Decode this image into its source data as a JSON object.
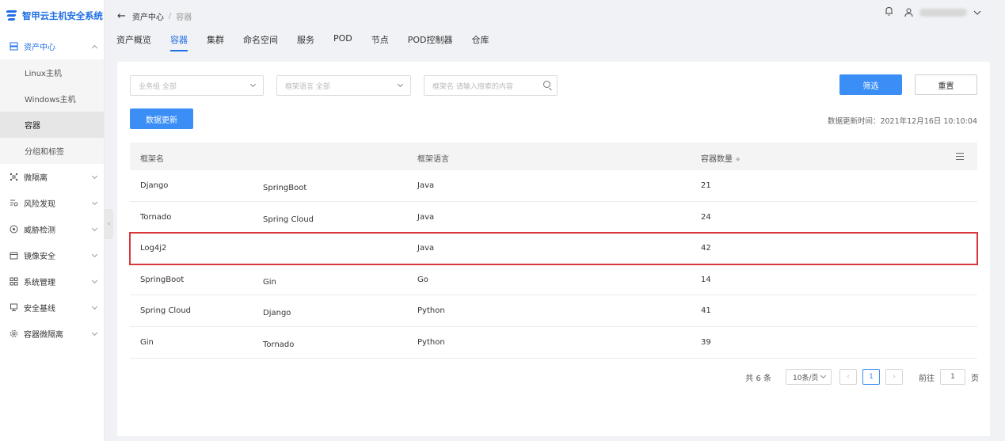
{
  "app": {
    "title": "智甲云主机安全系统"
  },
  "sidebar": {
    "groups": [
      {
        "label": "资产中心",
        "expanded": true
      },
      {
        "label": "微隔离"
      },
      {
        "label": "风险发现"
      },
      {
        "label": "威胁检测"
      },
      {
        "label": "镜像安全"
      },
      {
        "label": "系统管理"
      },
      {
        "label": "安全基线"
      },
      {
        "label": "容器微隔离"
      }
    ],
    "sub_items": [
      "Linux主机",
      "Windows主机",
      "容器",
      "分组和标签"
    ],
    "active_sub": "容器"
  },
  "header": {
    "breadcrumb": {
      "parent": "资产中心",
      "separator": "/",
      "current": "容器"
    }
  },
  "tabs": [
    "资产概览",
    "容器",
    "集群",
    "命名空间",
    "服务",
    "POD",
    "节点",
    "POD控制器",
    "仓库"
  ],
  "active_tab": "容器",
  "filters": {
    "business_group": "业务组 全部",
    "framework_language": "框架语言 全部",
    "search_placeholder": "框架名 请输入搜索的内容"
  },
  "buttons": {
    "filter": "筛选",
    "reset": "重置",
    "data_update": "数据更新"
  },
  "update_time": "数据更新时间：2021年12月16日 10:10:04",
  "table": {
    "columns": [
      "框架名",
      "框架语言",
      "容器数量"
    ],
    "rows": [
      {
        "name": "Django",
        "sub": "SpringBoot",
        "language": "Java",
        "count": "21"
      },
      {
        "name": "Tornado",
        "sub": "Spring Cloud",
        "language": "Java",
        "count": "24"
      },
      {
        "name": "Log4j2",
        "sub": "",
        "language": "Java",
        "count": "42",
        "highlighted": true
      },
      {
        "name": "SpringBoot",
        "sub": "Gin",
        "language": "Go",
        "count": "14"
      },
      {
        "name": "Spring Cloud",
        "sub": "Django",
        "language": "Python",
        "count": "41"
      },
      {
        "name": "Gin",
        "sub": "Tornado",
        "language": "Python",
        "count": "39"
      }
    ]
  },
  "pagination": {
    "total": "共 6 条",
    "page_size": "10条/页",
    "prev": "‹",
    "current": "1",
    "next": "›",
    "goto_label": "前往",
    "goto_value": "1",
    "page_suffix": "页"
  },
  "colors": {
    "primary": "#3a8ef6",
    "brand": "#1f6fe5",
    "highlight_border": "#d9363e"
  }
}
